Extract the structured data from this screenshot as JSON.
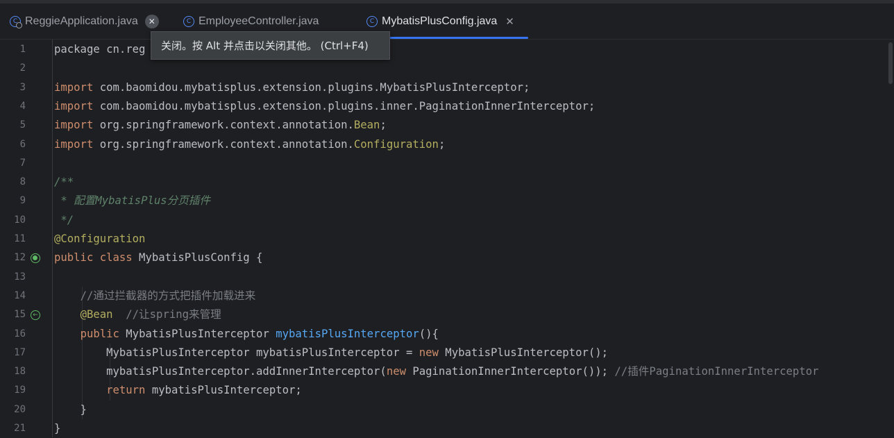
{
  "tabs": [
    {
      "label": "ReggieApplication.java",
      "icon": "class-run-icon",
      "state": "hover"
    },
    {
      "label": "EmployeeController.java",
      "icon": "class-icon",
      "state": "normal"
    },
    {
      "label": "MybatisPlusConfig.java",
      "icon": "class-icon",
      "state": "active"
    }
  ],
  "tooltip": "关闭。按 Alt 并点击以关闭其他。 (Ctrl+F4)",
  "line_numbers": [
    "1",
    "2",
    "3",
    "4",
    "5",
    "6",
    "7",
    "8",
    "9",
    "10",
    "11",
    "12",
    "13",
    "14",
    "15",
    "16",
    "17",
    "18",
    "19",
    "20",
    "21"
  ],
  "code_lines": [
    [
      [
        "",
        "package cn.reg"
      ]
    ],
    [],
    [
      [
        "kw",
        "import"
      ],
      [
        "",
        " com.baomidou.mybatisplus.extension.plugins.MybatisPlusInterceptor;"
      ]
    ],
    [
      [
        "kw",
        "import"
      ],
      [
        "",
        " com.baomidou.mybatisplus.extension.plugins.inner.PaginationInnerInterceptor;"
      ]
    ],
    [
      [
        "kw",
        "import"
      ],
      [
        "",
        " org.springframework.context.annotation."
      ],
      [
        "an",
        "Bean"
      ],
      [
        "",
        ";"
      ]
    ],
    [
      [
        "kw",
        "import"
      ],
      [
        "",
        " org.springframework.context.annotation."
      ],
      [
        "an",
        "Configuration"
      ],
      [
        "",
        ";"
      ]
    ],
    [],
    [
      [
        "dc",
        "/**"
      ]
    ],
    [
      [
        "dc",
        " * 配置MybatisPlus分页插件"
      ]
    ],
    [
      [
        "dc",
        " */"
      ]
    ],
    [
      [
        "an",
        "@Configuration"
      ]
    ],
    [
      [
        "kw",
        "public class"
      ],
      [
        "",
        " MybatisPlusConfig {"
      ]
    ],
    [],
    [
      [
        "",
        "    "
      ],
      [
        "cm",
        "//通过拦截器的方式把插件加载进来"
      ]
    ],
    [
      [
        "",
        "    "
      ],
      [
        "an",
        "@Bean"
      ],
      [
        "",
        "  "
      ],
      [
        "cm",
        "//让spring来管理"
      ]
    ],
    [
      [
        "",
        "    "
      ],
      [
        "kw",
        "public"
      ],
      [
        "",
        " MybatisPlusInterceptor "
      ],
      [
        "fn",
        "mybatisPlusInterceptor"
      ],
      [
        "",
        "(){"
      ]
    ],
    [
      [
        "",
        "        MybatisPlusInterceptor mybatisPlusInterceptor = "
      ],
      [
        "kw",
        "new"
      ],
      [
        "",
        " MybatisPlusInterceptor();"
      ]
    ],
    [
      [
        "",
        "        mybatisPlusInterceptor.addInnerInterceptor("
      ],
      [
        "kw",
        "new"
      ],
      [
        "",
        " PaginationInnerInterceptor()); "
      ],
      [
        "cm",
        "//插件PaginationInnerInterceptor"
      ]
    ],
    [
      [
        "",
        "        "
      ],
      [
        "kw",
        "return"
      ],
      [
        "",
        " mybatisPlusInterceptor;"
      ]
    ],
    [
      [
        "",
        "    }"
      ]
    ],
    [
      [
        "",
        "}"
      ]
    ]
  ],
  "gutter_icons": [
    {
      "line": 12,
      "icon": "spring-bean-icon"
    },
    {
      "line": 15,
      "icon": "spring-bean-navigate-icon"
    }
  ],
  "colors": {
    "background": "#1e1f22",
    "keyword": "#cf8e6d",
    "annotation": "#b3ae60",
    "function": "#56a8f5",
    "comment": "#7a7e85",
    "doc_comment": "#5f826b",
    "accent": "#3574f0"
  }
}
